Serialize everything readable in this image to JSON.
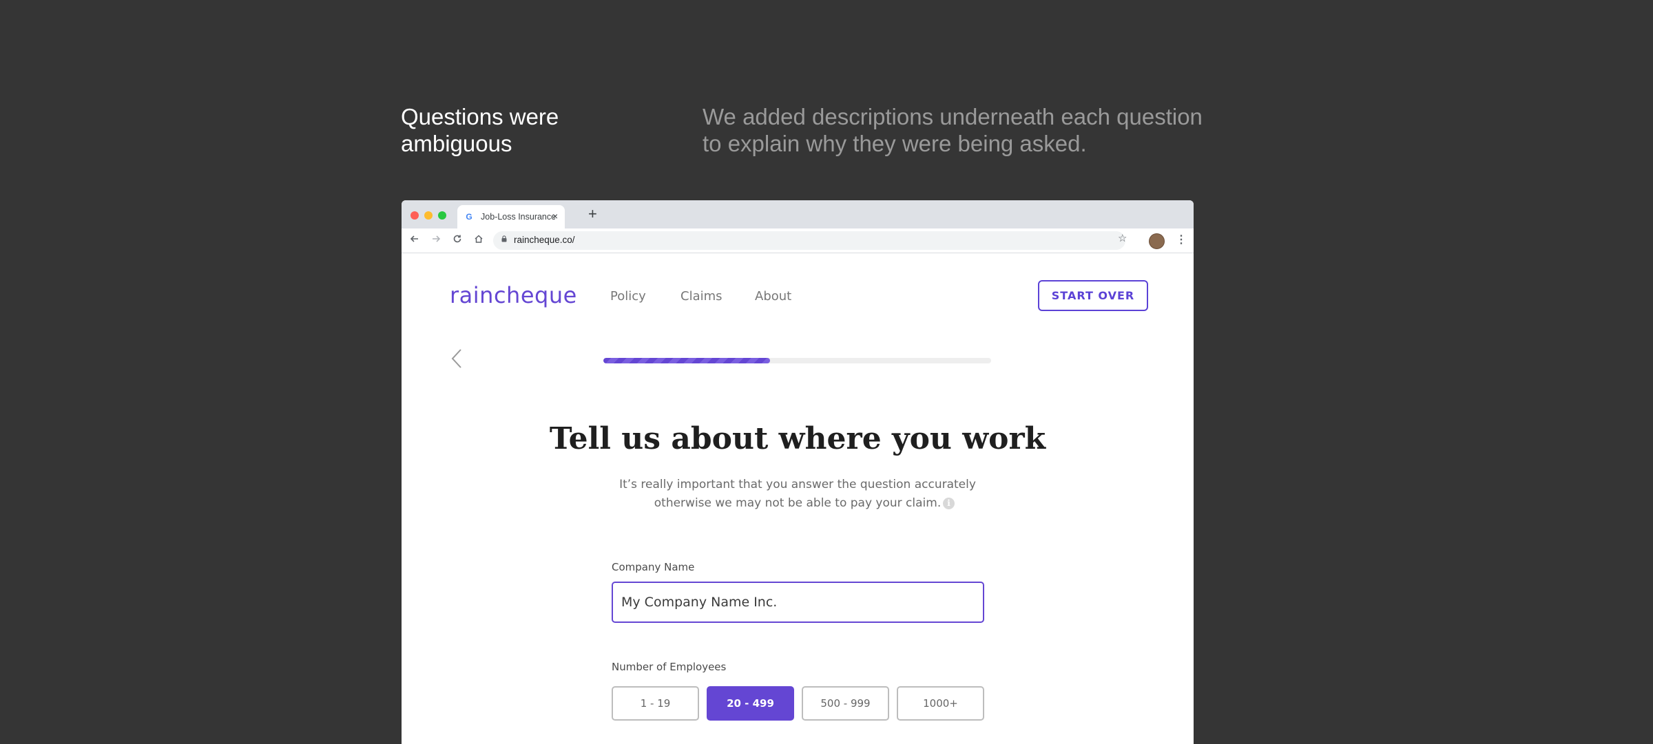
{
  "caption": {
    "title": "Questions were ambiguous",
    "description": "We added descriptions underneath each question to explain why they were being asked."
  },
  "browser": {
    "tab_title": "Job-Loss Insurance",
    "tab_favicon": "G",
    "tab_close": "×",
    "new_tab": "+",
    "url": "raincheque.co/"
  },
  "site": {
    "logo": "raincheque",
    "nav": [
      "Policy",
      "Claims",
      "About"
    ],
    "start_over": "START OVER"
  },
  "progress": {
    "value": 0.43
  },
  "form": {
    "heading": "Tell us about where you work",
    "subtext_line1": "It’s really important that you answer the question accurately",
    "subtext_line2": "otherwise we may not be able to pay your claim.",
    "info_icon": "i",
    "company_label": "Company Name",
    "company_value": "My Company Name Inc.",
    "employees_label": "Number of Employees",
    "employee_options": [
      "1 - 19",
      "20 - 499",
      "500 - 999",
      "1000+"
    ],
    "selected_option": "20 - 499"
  },
  "colors": {
    "brand": "#6446d3",
    "background": "#353535"
  }
}
